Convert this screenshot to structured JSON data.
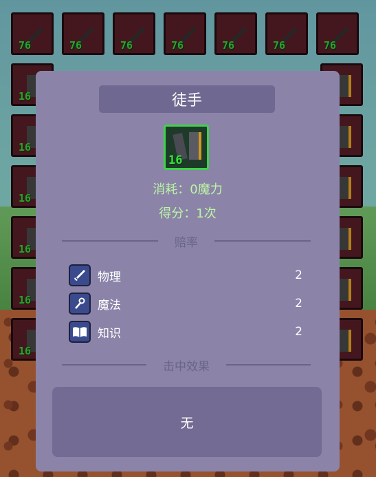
{
  "background": {
    "slots_top_row": [
      "76",
      "76",
      "76",
      "76",
      "76",
      "76",
      "76"
    ],
    "slots_side": [
      "16",
      "16",
      "16",
      "16",
      "16",
      "16"
    ]
  },
  "panel": {
    "title": "徒手",
    "item_level": "16",
    "cost": "消耗：0魔力",
    "score": "得分：1次",
    "odds_label": "赔率",
    "stats": [
      {
        "name": "物理",
        "value": "2",
        "icon": "sword-icon"
      },
      {
        "name": "魔法",
        "value": "2",
        "icon": "staff-icon"
      },
      {
        "name": "知识",
        "value": "2",
        "icon": "book-icon"
      }
    ],
    "hit_effect_label": "击中效果",
    "hit_effect_value": "无"
  },
  "colors": {
    "panel_bg": "#8b84a8",
    "title_bar": "#6f6890",
    "info_text": "#bdf5a4",
    "level_green": "#37e03c"
  }
}
